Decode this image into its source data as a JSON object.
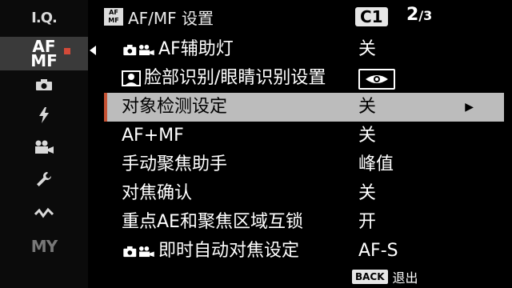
{
  "sidebar": {
    "items": [
      {
        "key": "iq",
        "label": "I.Q.",
        "icon": "image-quality-icon",
        "selected": false
      },
      {
        "key": "af",
        "label_top": "AF",
        "label_bottom": "MF",
        "icon": "af-mf-icon",
        "selected": true
      },
      {
        "key": "shooting",
        "label": "",
        "icon": "camera-icon",
        "selected": false
      },
      {
        "key": "flash",
        "label": "",
        "icon": "flash-icon",
        "selected": false
      },
      {
        "key": "movie",
        "label": "",
        "icon": "movie-camera-icon",
        "selected": false
      },
      {
        "key": "setup",
        "label": "",
        "icon": "wrench-icon",
        "selected": false
      },
      {
        "key": "connection",
        "label": "",
        "icon": "wireless-icon",
        "selected": false
      },
      {
        "key": "my",
        "label": "MY",
        "icon": "my-menu-icon",
        "selected": false
      }
    ]
  },
  "header": {
    "icon_top": "AF",
    "icon_bottom": "MF",
    "title": "AF/MF 设置",
    "mode": "C1",
    "page_current": "2",
    "page_total": "/3"
  },
  "rows": [
    {
      "label": "AF辅助灯",
      "value": "关",
      "icon": "photo-movie-icon",
      "highlight": false
    },
    {
      "label": "脸部识别/眼睛识别设置",
      "value": "",
      "value_icon": "eye-detection-icon",
      "icon": "face-icon",
      "highlight": false
    },
    {
      "label": "对象检测设定",
      "value": "关",
      "arrow": "▶",
      "highlight": true
    },
    {
      "label": "AF+MF",
      "value": "关",
      "highlight": false
    },
    {
      "label": "手动聚焦助手",
      "value": "峰值",
      "highlight": false
    },
    {
      "label": "对焦确认",
      "value": "关",
      "highlight": false
    },
    {
      "label": "重点AE和聚焦区域互锁",
      "value": "开",
      "highlight": false
    },
    {
      "label": "即时自动对焦设定",
      "value": "AF-S",
      "icon": "photo-movie-icon",
      "highlight": false
    }
  ],
  "footer": {
    "back_button": "BACK",
    "back_label": "退出"
  },
  "colors": {
    "accent_red": "#c55234",
    "highlight_bg": "#bcbcbc",
    "selected_tab_bg": "#3a3a3a"
  }
}
